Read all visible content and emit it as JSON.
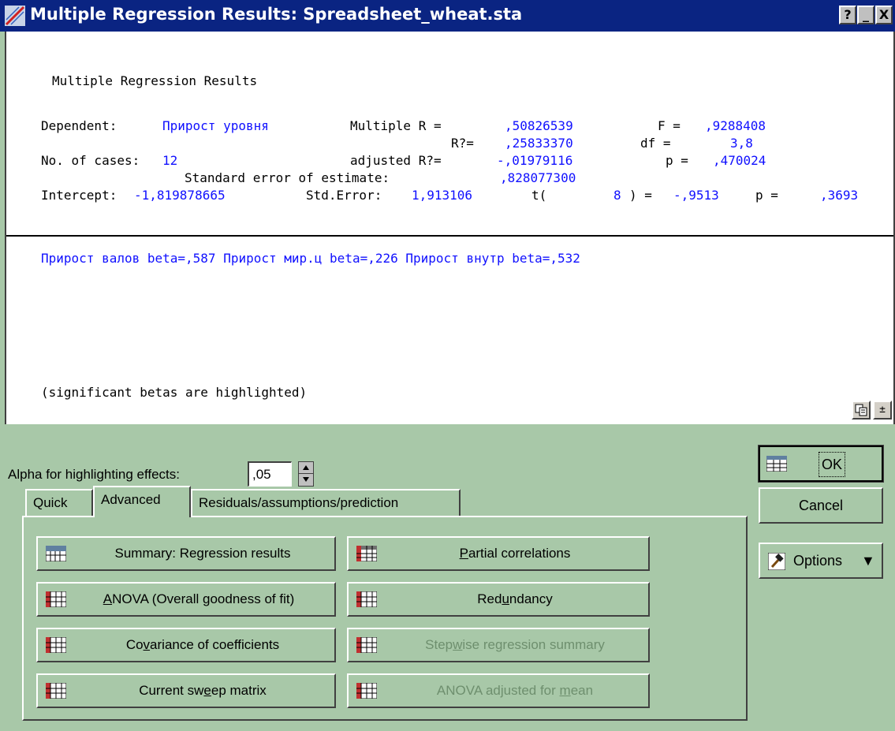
{
  "window": {
    "title": "Multiple Regression Results: Spreadsheet_wheat.sta",
    "help_btn": "?",
    "min_btn": "_",
    "close_btn": "X"
  },
  "report": {
    "heading": "Multiple Regression Results",
    "dependent_label": "Dependent:",
    "dependent_value": "Прирост уровня",
    "multiple_r_label": "Multiple R =",
    "multiple_r_value": ",50826539",
    "f_label": "F =",
    "f_value": ",9288408",
    "r2_label": "R?=",
    "r2_value": ",25833370",
    "df_label": "df =",
    "df_value": "3,8",
    "cases_label": "No. of cases:",
    "cases_value": "12",
    "adj_r2_label": "adjusted R?=",
    "adj_r2_value": "-,01979116",
    "p_label": "p =",
    "p_value": ",470024",
    "se_label": "Standard error of estimate:",
    "se_value": ",828077300",
    "intercept_label": "Intercept:",
    "intercept_value": "-1,819878665",
    "std_error_label": "Std.Error:",
    "std_error_value": "1,913106",
    "t_label_open": "t(",
    "t_df": "8",
    "t_label_close": ") =",
    "t_value": "-,9513",
    "p2_label": "p =",
    "p2_value": ",3693",
    "betas_line": "Прирост валов beta=,587 Прирост мир.ц beta=,226 Прирост внутр beta=,532",
    "footnote": "(significant betas are highlighted)"
  },
  "alpha": {
    "label": "Alpha for highlighting effects:",
    "value": ",05"
  },
  "tabs": [
    {
      "label": "Quick",
      "active": false
    },
    {
      "label": "Advanced",
      "active": true
    },
    {
      "label": "Residuals/assumptions/prediction",
      "active": false
    }
  ],
  "buttons": {
    "summary": "Summary:  Regression results",
    "anova_pre": "",
    "anova_u": "A",
    "anova_post": "NOVA (Overall goodness of fit)",
    "cov_pre": "Co",
    "cov_u": "v",
    "cov_post": "ariance of coefficients",
    "sweep_pre": "Current sw",
    "sweep_u": "e",
    "sweep_post": "ep matrix",
    "partial_pre": "",
    "partial_u": "P",
    "partial_post": "artial correlations",
    "redundancy_pre": "Red",
    "redundancy_u": "u",
    "redundancy_post": "ndancy",
    "stepwise_pre": "Step",
    "stepwise_u": "w",
    "stepwise_post": "ise regression summary",
    "anova_mean_pre": "ANOVA adjusted for ",
    "anova_mean_u": "m",
    "anova_mean_post": "ean"
  },
  "side": {
    "ok": "OK",
    "cancel": "Cancel",
    "options": "Options"
  },
  "icons": {
    "app": "scatter-plot-icon",
    "summary": "summary-spreadsheet-icon",
    "grid": "spreadsheet-grid-icon",
    "copy": "copy-icon",
    "expand": "expand-icon",
    "options": "hammer-icon",
    "ok": "spreadsheet-icon"
  },
  "colors": {
    "title_bar": "#0a2482",
    "panel": "#a8c8a8",
    "highlight_text": "#1010ff"
  }
}
